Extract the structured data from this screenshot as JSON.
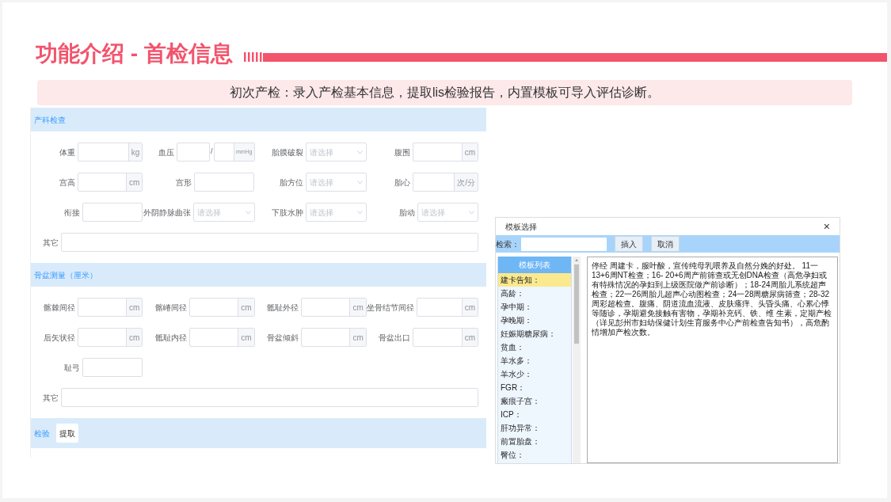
{
  "header": {
    "title": "功能介绍 - 首检信息",
    "subtitle": "初次产检：录入产检基本信息，提取lis检验报告，内置模板可导入评估诊断。"
  },
  "form": {
    "sections": [
      {
        "title": "产科检查",
        "rows": [
          [
            {
              "label": "体重",
              "kind": "unit",
              "unit": "kg"
            },
            {
              "label": "血压",
              "kind": "bp",
              "separator": "/",
              "unit": "mmHg"
            },
            {
              "label": "胎膜破裂",
              "kind": "select",
              "placeholder": "请选择"
            },
            {
              "label": "腹围",
              "kind": "unit",
              "unit": "cm"
            }
          ],
          [
            {
              "label": "宫高",
              "kind": "unit",
              "unit": "cm"
            },
            {
              "label": "宫形",
              "kind": "text"
            },
            {
              "label": "胎方位",
              "kind": "select",
              "placeholder": "请选择"
            },
            {
              "label": "胎心",
              "kind": "unit",
              "unit": "次/分"
            }
          ],
          [
            {
              "label": "衔接",
              "kind": "text"
            },
            {
              "label": "外阴静脉曲张",
              "kind": "select",
              "placeholder": "请选择"
            },
            {
              "label": "下肢水肿",
              "kind": "select",
              "placeholder": "请选择"
            },
            {
              "label": "胎动",
              "kind": "select",
              "placeholder": "请选择"
            }
          ]
        ],
        "other": "其它"
      },
      {
        "title": "骨盆测量（厘米）",
        "rows": [
          [
            {
              "label": "髂棘间径",
              "kind": "unit",
              "unit": "cm"
            },
            {
              "label": "髂嵴间径",
              "kind": "unit",
              "unit": "cm"
            },
            {
              "label": "骶耻外径",
              "kind": "unit",
              "unit": "cm"
            },
            {
              "label": "坐骨结节间径",
              "kind": "unit",
              "unit": "cm"
            }
          ],
          [
            {
              "label": "后矢状径",
              "kind": "unit",
              "unit": "cm"
            },
            {
              "label": "骶耻内径",
              "kind": "unit",
              "unit": "cm"
            },
            {
              "label": "骨盆倾斜",
              "kind": "unit",
              "unit": "cm"
            },
            {
              "label": "骨盆出口",
              "kind": "unit",
              "unit": "cm"
            }
          ],
          [
            {
              "label": "耻弓",
              "kind": "text"
            }
          ]
        ],
        "other": "其它"
      }
    ],
    "lab": {
      "title": "检验",
      "button": "提取"
    }
  },
  "dialog": {
    "title": "模板选择",
    "close": "×",
    "search_label": "检索：",
    "buttons": [
      "插入",
      "取消"
    ],
    "list_title": "模板列表",
    "items": [
      {
        "label": "建卡告知：",
        "selected": true
      },
      {
        "label": "高龄：",
        "selected": false
      },
      {
        "label": "孕中期：",
        "selected": false
      },
      {
        "label": "孕晚期：",
        "selected": false
      },
      {
        "label": "妊娠期糖尿病：",
        "selected": false
      },
      {
        "label": "贫血：",
        "selected": false
      },
      {
        "label": "羊水多：",
        "selected": false
      },
      {
        "label": "羊水少：",
        "selected": false
      },
      {
        "label": "FGR：",
        "selected": false
      },
      {
        "label": "瘢痕子宫：",
        "selected": false
      },
      {
        "label": "ICP：",
        "selected": false
      },
      {
        "label": "肝功异常：",
        "selected": false
      },
      {
        "label": "前置胎盘：",
        "selected": false
      },
      {
        "label": "臀位：",
        "selected": false
      }
    ],
    "content": "停经  周建卡，服叶酸，宣传纯母乳喂养及自然分娩的好处。 11一 13+6周NT检查；16- 20+6周产前筛查或无创DNA检查（高危孕妇或有特殊情况的孕妇到上级医院做产前诊断）；18-24周胎儿系统超声检查；22一26周胎儿超声心动图检查；24一28周糖尿病筛查；28-32周彩超检查。腹痛、阴道流血流液、皮肤瘙痒、头昏头痛、心累心悸等随诊，孕期避免接触有害物，孕期补充钙、铁、维 生素，定期产检（详见彭州市妇幼保健计划生育服务中心产前检查告知书），高危酌情增加产检次数。"
  }
}
